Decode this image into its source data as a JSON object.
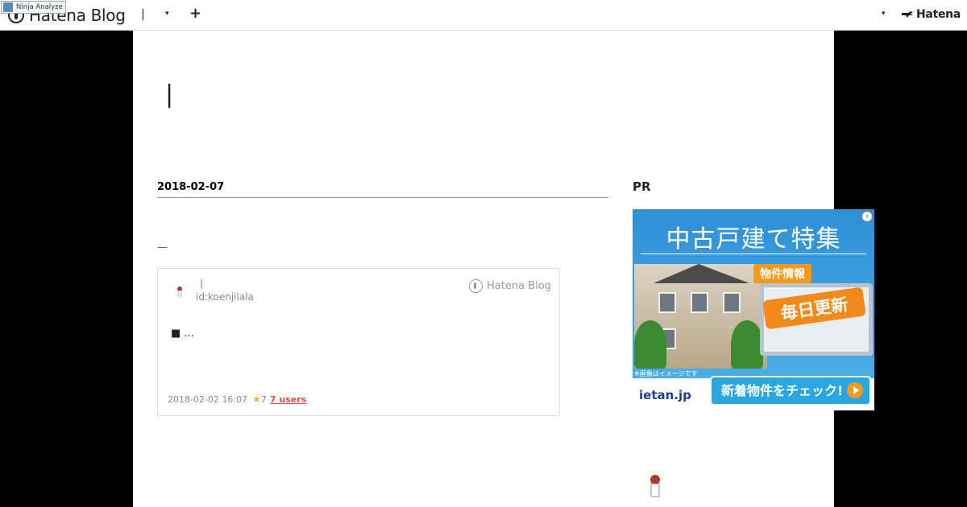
{
  "toolbar": {
    "ninja_label": "Ninja Analyze",
    "brand": "Hatena Blog",
    "blog_title": "|",
    "dropdown_glyph": "▾",
    "add_glyph": "+",
    "user_dropdown_glyph": "▾",
    "hatena_logo": "Hatena"
  },
  "blog": {
    "title": "|"
  },
  "entry": {
    "date": "2018-02-07",
    "title_link": "—",
    "embed": {
      "author": "|",
      "author_id": "id:koenjilala",
      "brand": "Hatena Blog",
      "excerpt": "■ ...",
      "posted_at": "2018-02-02 16:07",
      "star_glyph": "★",
      "star_count": "7",
      "users_label": "7 users"
    }
  },
  "sidebar": {
    "pr_heading": "PR",
    "ad": {
      "info_glyph": "i",
      "headline": "中古戸建て特集",
      "badge": "物件情報",
      "callout": "毎日更新",
      "note": "※画像はイメージです",
      "logo": "ietan.jp",
      "cta": "新着物件をチェック!"
    }
  },
  "colors": {
    "page_background": "#000000",
    "link": "#1b6fbf",
    "users_link": "#e64b4b",
    "star": "#f0b429"
  }
}
